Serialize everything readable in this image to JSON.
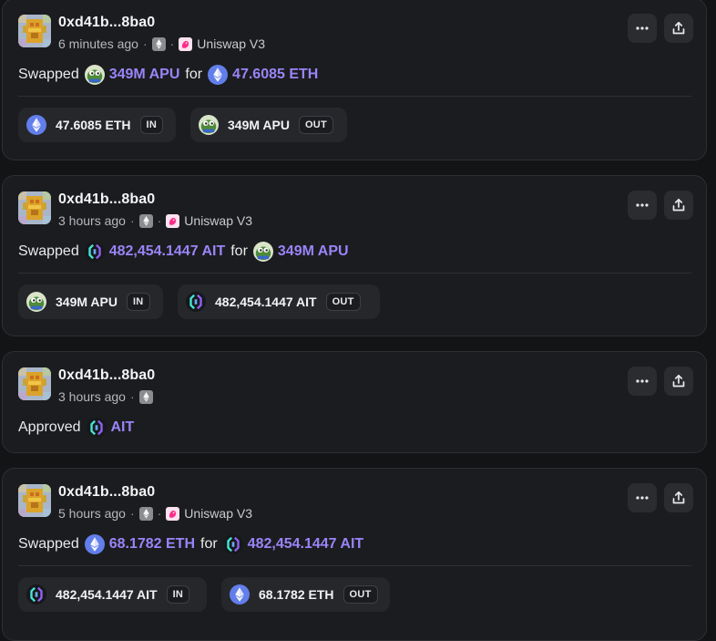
{
  "icons": {
    "more": "more-horizontal-icon",
    "share": "share-icon",
    "chain": "ethereum-chain-icon",
    "protocol": "uniswap-icon",
    "eth": "eth-token-icon",
    "apu": "apu-token-icon",
    "ait": "ait-token-icon"
  },
  "colors": {
    "accent": "#9a84f8",
    "eth": "#627eea",
    "ait_cyan": "#46e5d6",
    "ait_purple": "#8f62f5"
  },
  "cards": [
    {
      "address": "0xd41b...8ba0",
      "time": "6 minutes ago",
      "protocol": "Uniswap V3",
      "verb": "Swapped",
      "token_a": "349M APU",
      "connector": "for",
      "token_b": "47.6085 ETH",
      "in": {
        "amount": "47.6085 ETH",
        "label": "IN"
      },
      "out": {
        "amount": "349M APU",
        "label": "OUT"
      }
    },
    {
      "address": "0xd41b...8ba0",
      "time": "3 hours ago",
      "protocol": "Uniswap V3",
      "verb": "Swapped",
      "token_a": "482,454.1447 AIT",
      "connector": "for",
      "token_b": "349M APU",
      "in": {
        "amount": "349M APU",
        "label": "IN"
      },
      "out": {
        "amount": "482,454.1447 AIT",
        "label": "OUT"
      }
    },
    {
      "address": "0xd41b...8ba0",
      "time": "3 hours ago",
      "verb": "Approved",
      "token_a": "AIT"
    },
    {
      "address": "0xd41b...8ba0",
      "time": "5 hours ago",
      "protocol": "Uniswap V3",
      "verb": "Swapped",
      "token_a": "68.1782 ETH",
      "connector": "for",
      "token_b": "482,454.1447 AIT",
      "in": {
        "amount": "482,454.1447 AIT",
        "label": "IN"
      },
      "out": {
        "amount": "68.1782 ETH",
        "label": "OUT"
      }
    }
  ]
}
